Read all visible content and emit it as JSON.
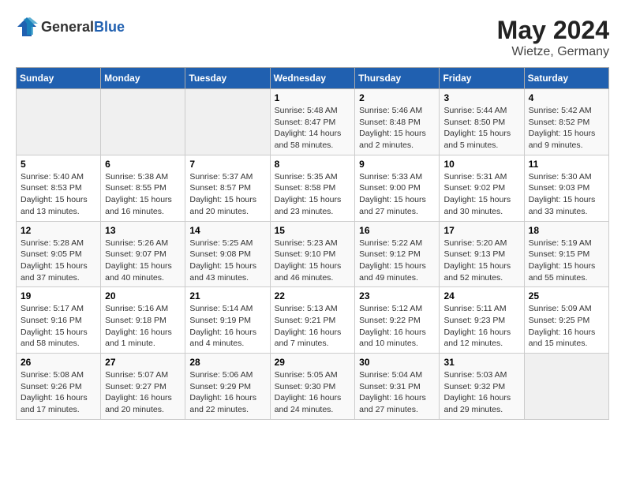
{
  "header": {
    "logo": {
      "text_general": "General",
      "text_blue": "Blue"
    },
    "month_year": "May 2024",
    "location": "Wietze, Germany"
  },
  "weekdays": [
    "Sunday",
    "Monday",
    "Tuesday",
    "Wednesday",
    "Thursday",
    "Friday",
    "Saturday"
  ],
  "weeks": [
    [
      {
        "day": "",
        "info": ""
      },
      {
        "day": "",
        "info": ""
      },
      {
        "day": "",
        "info": ""
      },
      {
        "day": "1",
        "info": "Sunrise: 5:48 AM\nSunset: 8:47 PM\nDaylight: 14 hours\nand 58 minutes."
      },
      {
        "day": "2",
        "info": "Sunrise: 5:46 AM\nSunset: 8:48 PM\nDaylight: 15 hours\nand 2 minutes."
      },
      {
        "day": "3",
        "info": "Sunrise: 5:44 AM\nSunset: 8:50 PM\nDaylight: 15 hours\nand 5 minutes."
      },
      {
        "day": "4",
        "info": "Sunrise: 5:42 AM\nSunset: 8:52 PM\nDaylight: 15 hours\nand 9 minutes."
      }
    ],
    [
      {
        "day": "5",
        "info": "Sunrise: 5:40 AM\nSunset: 8:53 PM\nDaylight: 15 hours\nand 13 minutes."
      },
      {
        "day": "6",
        "info": "Sunrise: 5:38 AM\nSunset: 8:55 PM\nDaylight: 15 hours\nand 16 minutes."
      },
      {
        "day": "7",
        "info": "Sunrise: 5:37 AM\nSunset: 8:57 PM\nDaylight: 15 hours\nand 20 minutes."
      },
      {
        "day": "8",
        "info": "Sunrise: 5:35 AM\nSunset: 8:58 PM\nDaylight: 15 hours\nand 23 minutes."
      },
      {
        "day": "9",
        "info": "Sunrise: 5:33 AM\nSunset: 9:00 PM\nDaylight: 15 hours\nand 27 minutes."
      },
      {
        "day": "10",
        "info": "Sunrise: 5:31 AM\nSunset: 9:02 PM\nDaylight: 15 hours\nand 30 minutes."
      },
      {
        "day": "11",
        "info": "Sunrise: 5:30 AM\nSunset: 9:03 PM\nDaylight: 15 hours\nand 33 minutes."
      }
    ],
    [
      {
        "day": "12",
        "info": "Sunrise: 5:28 AM\nSunset: 9:05 PM\nDaylight: 15 hours\nand 37 minutes."
      },
      {
        "day": "13",
        "info": "Sunrise: 5:26 AM\nSunset: 9:07 PM\nDaylight: 15 hours\nand 40 minutes."
      },
      {
        "day": "14",
        "info": "Sunrise: 5:25 AM\nSunset: 9:08 PM\nDaylight: 15 hours\nand 43 minutes."
      },
      {
        "day": "15",
        "info": "Sunrise: 5:23 AM\nSunset: 9:10 PM\nDaylight: 15 hours\nand 46 minutes."
      },
      {
        "day": "16",
        "info": "Sunrise: 5:22 AM\nSunset: 9:12 PM\nDaylight: 15 hours\nand 49 minutes."
      },
      {
        "day": "17",
        "info": "Sunrise: 5:20 AM\nSunset: 9:13 PM\nDaylight: 15 hours\nand 52 minutes."
      },
      {
        "day": "18",
        "info": "Sunrise: 5:19 AM\nSunset: 9:15 PM\nDaylight: 15 hours\nand 55 minutes."
      }
    ],
    [
      {
        "day": "19",
        "info": "Sunrise: 5:17 AM\nSunset: 9:16 PM\nDaylight: 15 hours\nand 58 minutes."
      },
      {
        "day": "20",
        "info": "Sunrise: 5:16 AM\nSunset: 9:18 PM\nDaylight: 16 hours\nand 1 minute."
      },
      {
        "day": "21",
        "info": "Sunrise: 5:14 AM\nSunset: 9:19 PM\nDaylight: 16 hours\nand 4 minutes."
      },
      {
        "day": "22",
        "info": "Sunrise: 5:13 AM\nSunset: 9:21 PM\nDaylight: 16 hours\nand 7 minutes."
      },
      {
        "day": "23",
        "info": "Sunrise: 5:12 AM\nSunset: 9:22 PM\nDaylight: 16 hours\nand 10 minutes."
      },
      {
        "day": "24",
        "info": "Sunrise: 5:11 AM\nSunset: 9:23 PM\nDaylight: 16 hours\nand 12 minutes."
      },
      {
        "day": "25",
        "info": "Sunrise: 5:09 AM\nSunset: 9:25 PM\nDaylight: 16 hours\nand 15 minutes."
      }
    ],
    [
      {
        "day": "26",
        "info": "Sunrise: 5:08 AM\nSunset: 9:26 PM\nDaylight: 16 hours\nand 17 minutes."
      },
      {
        "day": "27",
        "info": "Sunrise: 5:07 AM\nSunset: 9:27 PM\nDaylight: 16 hours\nand 20 minutes."
      },
      {
        "day": "28",
        "info": "Sunrise: 5:06 AM\nSunset: 9:29 PM\nDaylight: 16 hours\nand 22 minutes."
      },
      {
        "day": "29",
        "info": "Sunrise: 5:05 AM\nSunset: 9:30 PM\nDaylight: 16 hours\nand 24 minutes."
      },
      {
        "day": "30",
        "info": "Sunrise: 5:04 AM\nSunset: 9:31 PM\nDaylight: 16 hours\nand 27 minutes."
      },
      {
        "day": "31",
        "info": "Sunrise: 5:03 AM\nSunset: 9:32 PM\nDaylight: 16 hours\nand 29 minutes."
      },
      {
        "day": "",
        "info": ""
      }
    ]
  ]
}
